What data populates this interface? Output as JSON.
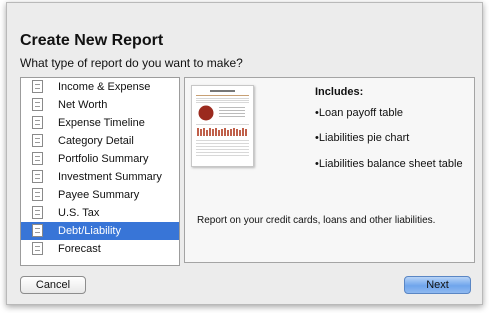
{
  "dialog": {
    "title": "Create New Report",
    "subtitle": "What type of report do you want to make?"
  },
  "report_types": [
    {
      "label": "Income & Expense",
      "icon": "pie-report-icon",
      "selected": false
    },
    {
      "label": "Net Worth",
      "icon": "pie-report-icon",
      "selected": false
    },
    {
      "label": "Expense Timeline",
      "icon": "table-report-icon",
      "selected": false
    },
    {
      "label": "Category Detail",
      "icon": "table-report-icon",
      "selected": false
    },
    {
      "label": "Portfolio Summary",
      "icon": "line-report-icon",
      "selected": false
    },
    {
      "label": "Investment Summary",
      "icon": "line-report-icon",
      "selected": false
    },
    {
      "label": "Payee Summary",
      "icon": "table-report-icon",
      "selected": false
    },
    {
      "label": "U.S. Tax",
      "icon": "table-report-icon",
      "selected": false
    },
    {
      "label": "Debt/Liability",
      "icon": "table-report-icon",
      "selected": true
    },
    {
      "label": "Forecast",
      "icon": "table-report-icon",
      "selected": false
    }
  ],
  "preview": {
    "includes_title": "Includes:",
    "includes": [
      "•Loan payoff table",
      "•Liabilities pie chart",
      "•Liabilities balance sheet table"
    ],
    "description": "Report on your credit cards, loans and other liabilities."
  },
  "buttons": {
    "cancel": "Cancel",
    "next": "Next"
  },
  "colors": {
    "selection": "#3875d7",
    "pie_accent": "#9b2a1e",
    "bar_accent": "#c0604a"
  }
}
